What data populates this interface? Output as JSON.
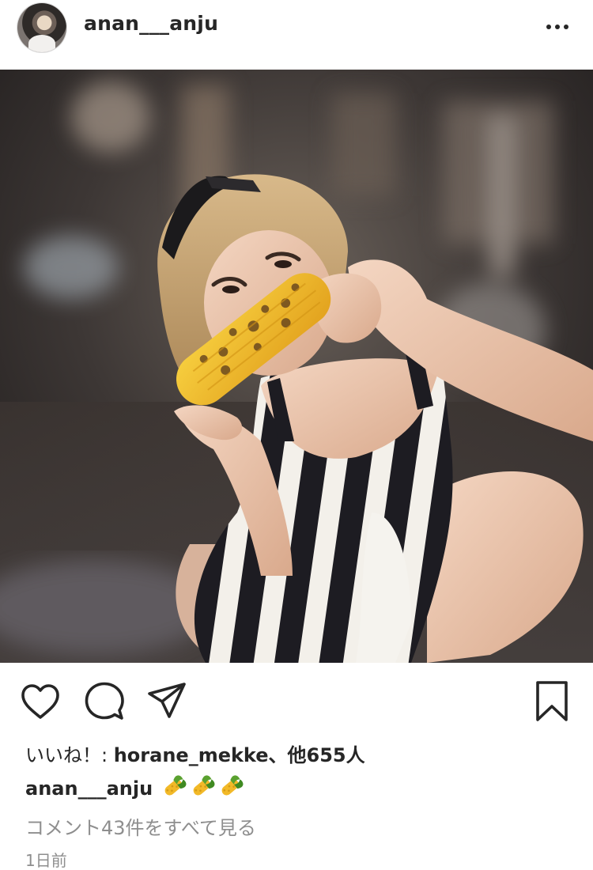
{
  "header": {
    "username": "anan___anju",
    "more_icon": "more-horizontal-icon"
  },
  "photo": {
    "subject": "woman in striped dress eating grilled corn"
  },
  "actions": {
    "like_icon": "heart-outline-icon",
    "comment_icon": "speech-bubble-icon",
    "share_icon": "paper-plane-icon",
    "save_icon": "bookmark-outline-icon"
  },
  "likes": {
    "prefix": "いいね！: ",
    "user": "horane_mekke",
    "suffix": "、他655人"
  },
  "caption": {
    "owner": "anan___anju",
    "emojis": [
      "corn-emoji",
      "corn-emoji",
      "corn-emoji"
    ]
  },
  "comments_link": "コメント43件をすべて見る",
  "timestamp": "1日前",
  "colors": {
    "text": "#262626",
    "muted": "#8e8e8e",
    "corn": "#f2b928"
  }
}
